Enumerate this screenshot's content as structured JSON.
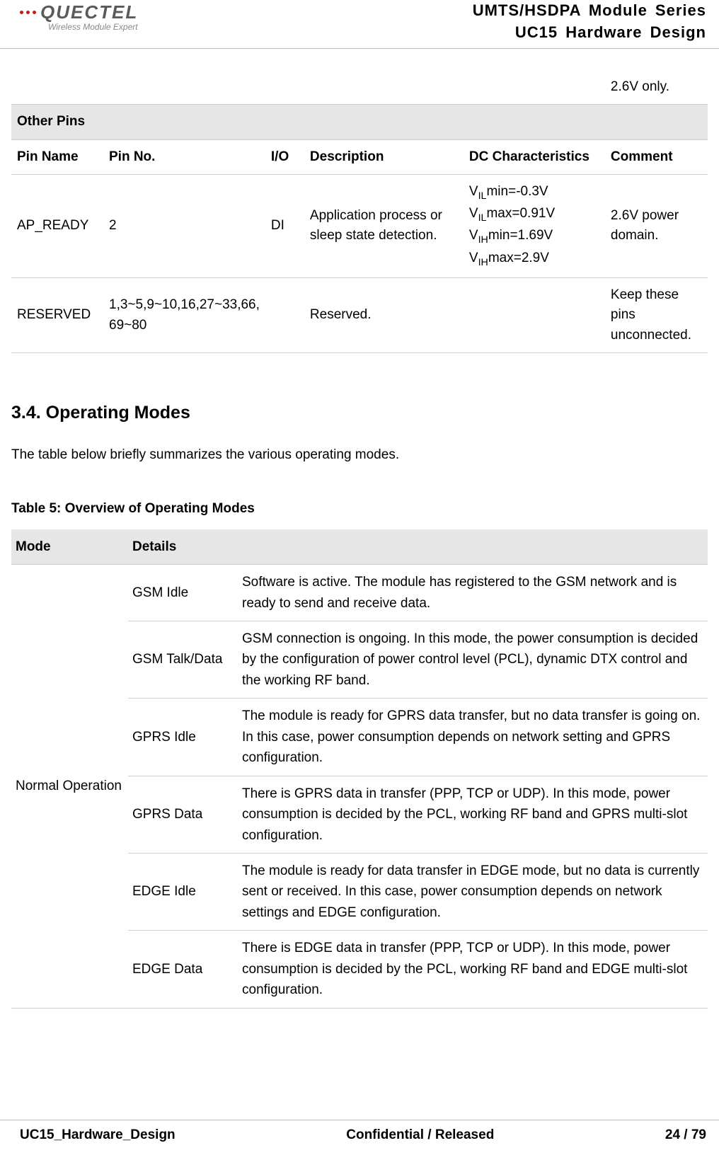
{
  "header": {
    "logo_main": "QUECTEL",
    "logo_tagline": "Wireless Module Expert",
    "doc_series": "UMTS/HSDPA Module Series",
    "doc_name": "UC15 Hardware Design"
  },
  "top_hanging_cell": "2.6V only.",
  "other_pins_section_title": "Other Pins",
  "pin_headers": {
    "pin_name": "Pin Name",
    "pin_no": "Pin No.",
    "io": "I/O",
    "description": "Description",
    "dc": "DC Characteristics",
    "comment": "Comment"
  },
  "pin_rows": [
    {
      "name": "AP_READY",
      "no": "2",
      "io": "DI",
      "desc": "Application process or sleep state detection.",
      "dc_lines": [
        {
          "prefix": "V",
          "sub": "IL",
          "rest": "min=-0.3V"
        },
        {
          "prefix": "V",
          "sub": "IL",
          "rest": "max=0.91V"
        },
        {
          "prefix": "V",
          "sub": "IH",
          "rest": "min=1.69V"
        },
        {
          "prefix": "V",
          "sub": "IH",
          "rest": "max=2.9V"
        }
      ],
      "comment": "2.6V power domain."
    },
    {
      "name": "RESERVED",
      "no": "1,3~5,9~10,16,27~33,66, 69~80",
      "io": "",
      "desc": "Reserved.",
      "dc_lines": [],
      "comment": "Keep these pins unconnected."
    }
  ],
  "section_number": "3.4.",
  "section_title": "Operating Modes",
  "section_intro": "The table below briefly summarizes the various operating modes.",
  "table5_caption": "Table 5: Overview of Operating Modes",
  "mode_headers": {
    "mode": "Mode",
    "details": "Details"
  },
  "mode_group_label": "Normal Operation",
  "mode_rows": [
    {
      "sub": "GSM Idle",
      "detail": "Software is active. The module has registered to the GSM network and is ready to send and receive data."
    },
    {
      "sub": "GSM Talk/Data",
      "detail": "GSM connection is ongoing. In this mode, the power consumption is decided by the configuration of power control level (PCL), dynamic DTX control and the working RF band."
    },
    {
      "sub": "GPRS Idle",
      "detail": "The module is ready for GPRS data transfer, but no data transfer is going on. In this case, power consumption depends on network setting and GPRS configuration."
    },
    {
      "sub": "GPRS Data",
      "detail": "There is GPRS data in transfer (PPP, TCP or UDP). In this mode, power consumption is decided by the PCL, working RF band and GPRS multi-slot configuration."
    },
    {
      "sub": "EDGE Idle",
      "detail": "The module is ready for data transfer in EDGE mode, but no data is currently sent or received. In this case, power consumption depends on network settings and EDGE configuration."
    },
    {
      "sub": "EDGE Data",
      "detail": "There is EDGE data in transfer (PPP, TCP or UDP). In this mode, power consumption is decided by the PCL, working RF band and EDGE multi-slot configuration."
    }
  ],
  "footer": {
    "left": "UC15_Hardware_Design",
    "center": "Confidential / Released",
    "right": "24 / 79"
  }
}
